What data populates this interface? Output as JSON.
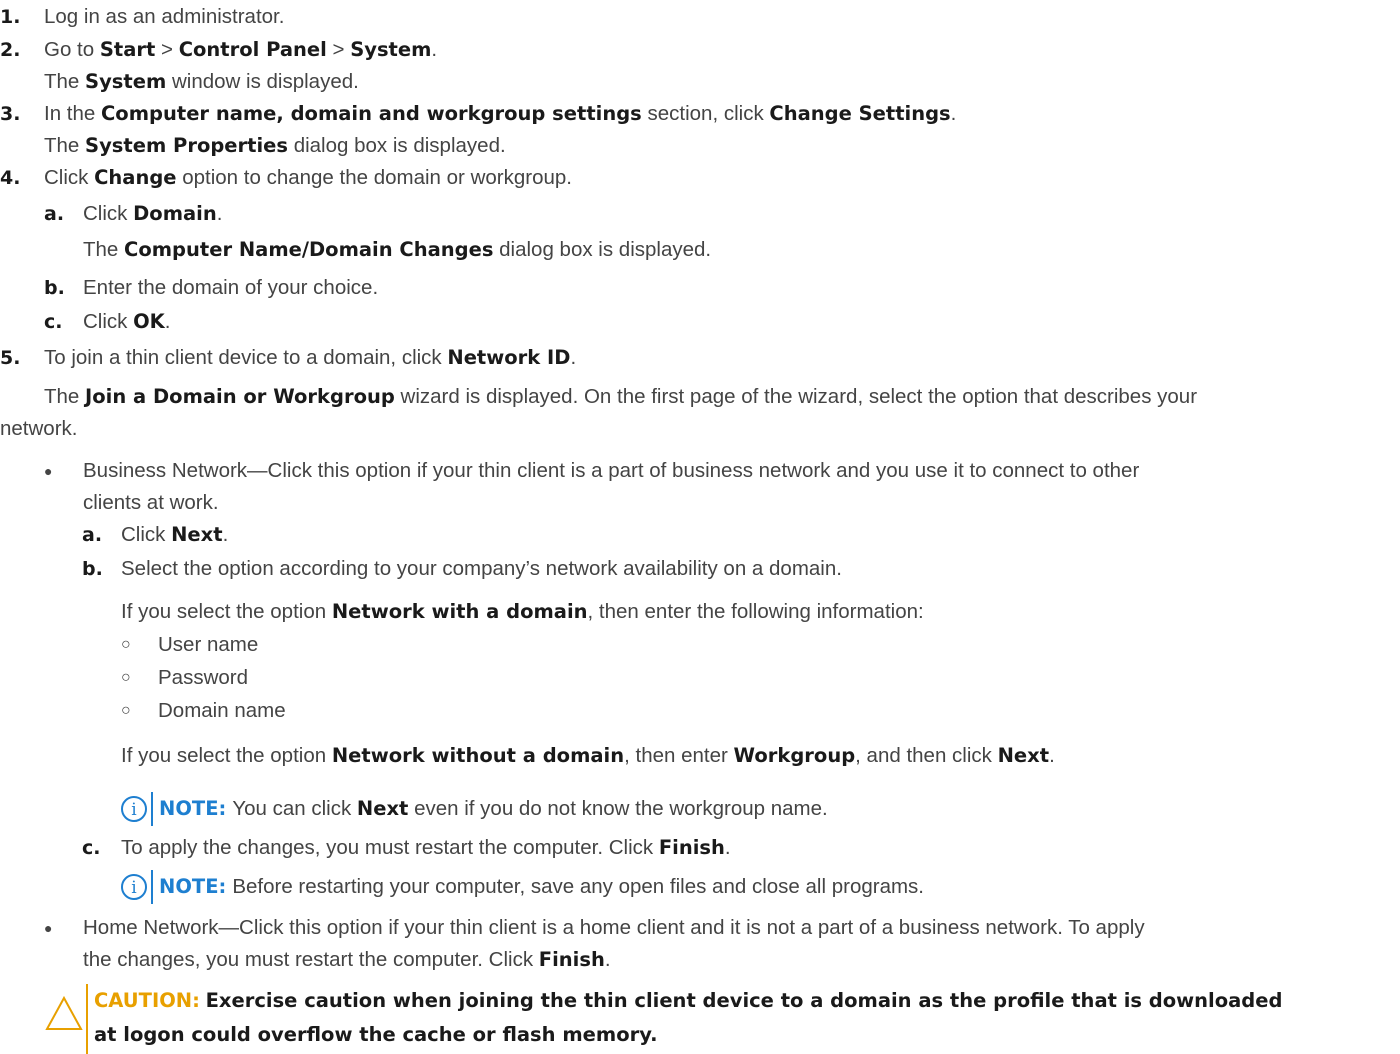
{
  "steps": {
    "s1": {
      "num": "1.",
      "text": "Log in as an administrator."
    },
    "s2": {
      "num": "2.",
      "t1": "Go to ",
      "b1": "Start",
      "t2": " > ",
      "b2": "Control Panel",
      "t3": " > ",
      "b3": "System",
      "t4": ".",
      "r1": "The ",
      "rb": "System",
      "r2": " window is displayed."
    },
    "s3": {
      "num": "3.",
      "t1": "In the ",
      "b1": "Computer name, domain and workgroup settings",
      "t2": " section, click ",
      "b2": "Change Settings",
      "t3": ".",
      "r1": "The ",
      "rb": "System Properties",
      "r2": " dialog box is displayed."
    },
    "s4": {
      "num": "4.",
      "t1": "Click ",
      "b1": "Change",
      "t2": " option to change the domain or workgroup.",
      "a": {
        "num": "a.",
        "t1": "Click ",
        "b1": "Domain",
        "t2": ".",
        "r1": "The ",
        "rb": "Computer Name/Domain Changes",
        "r2": " dialog box is displayed."
      },
      "b": {
        "num": "b.",
        "text": "Enter the domain of your choice."
      },
      "c": {
        "num": "c.",
        "t1": "Click ",
        "b1": "OK",
        "t2": "."
      }
    },
    "s5": {
      "num": "5.",
      "t1": "To join a thin client device to a domain, click ",
      "b1": "Network ID",
      "t2": ".",
      "p1": "The ",
      "pb": "Join a Domain or Workgroup",
      "p2": " wizard is displayed. On the first page of the wizard, select the option that describes your",
      "p3": "network.",
      "business": {
        "bullet": "●",
        "line1": "Business Network—Click this option if your thin client is a part of business network and you use it to connect to other",
        "line2": "clients at work.",
        "a": {
          "num": "a.",
          "t1": "Click ",
          "b1": "Next",
          "t2": "."
        },
        "b": {
          "num": "b.",
          "text": "Select the option according to your company’s network availability on a domain.",
          "w1": "If you select the option ",
          "wb": "Network with a domain",
          "w2": ", then enter the following information:",
          "circle": "○",
          "items": [
            "User name",
            "Password",
            "Domain name"
          ],
          "n1": "If you select the option ",
          "nb1": "Network without a domain",
          "n2": ", then enter ",
          "nb2": "Workgroup",
          "n3": ", and then click ",
          "nb3": "Next",
          "n4": ".",
          "note": {
            "label": "NOTE:",
            "t1": "You can click ",
            "b1": "Next",
            "t2": " even if you do not know the workgroup name."
          }
        },
        "c": {
          "num": "c.",
          "t1": "To apply the changes, you must restart the computer. Click ",
          "b1": "Finish",
          "t2": ".",
          "note": {
            "label": "NOTE:",
            "text": "Before restarting your computer, save any open files and close all programs."
          }
        }
      },
      "home": {
        "bullet": "●",
        "line1": "Home Network—Click this option if your thin client is a home client and it is not a part of a business network. To apply",
        "l2a": "the changes, you must restart the computer. Click ",
        "l2b": "Finish",
        "l2c": "."
      },
      "caution": {
        "label": "CAUTION:",
        "line1": "Exercise caution when joining the thin client device to a domain as the profile that is downloaded",
        "line2": "at logon could overflow the cache or flash memory."
      }
    }
  },
  "colors": {
    "note": "#1e7fd0",
    "caution": "#e8a000"
  },
  "icons": {
    "note": "info-icon",
    "caution": "warning-triangle-icon"
  }
}
